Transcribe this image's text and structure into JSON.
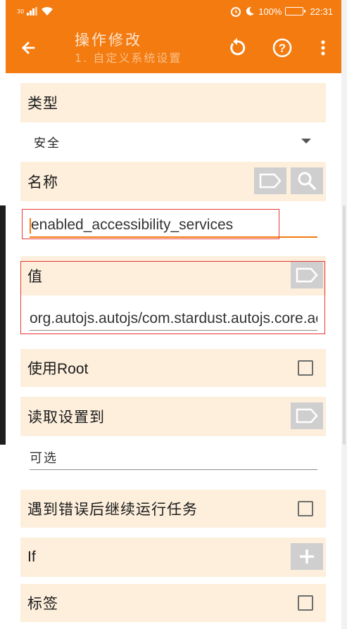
{
  "status_bar": {
    "signal_label": "30",
    "battery_text": "100%",
    "time": "22:31"
  },
  "toolbar": {
    "title": "操作修改",
    "subtitle": "1. 自定义系统设置"
  },
  "type_section": {
    "label": "类型",
    "selected": "安全"
  },
  "name_section": {
    "label": "名称",
    "value": "enabled_accessibility_services"
  },
  "value_section": {
    "label": "值",
    "value": "org.autojs.autojs/com.stardust.autojs.core.accessibility.AccessibilityService"
  },
  "use_root": {
    "label": "使用Root",
    "checked": false
  },
  "read_setting": {
    "label": "读取设置到",
    "placeholder": "可选"
  },
  "continue_on_error": {
    "label": "遇到错误后继续运行任务",
    "checked": false
  },
  "if_section": {
    "label": "If"
  },
  "tags_section": {
    "label": "标签",
    "checked": false
  },
  "colors": {
    "accent": "#f47b0f",
    "row_bg": "#fdefdc",
    "highlight": "#e53935"
  }
}
